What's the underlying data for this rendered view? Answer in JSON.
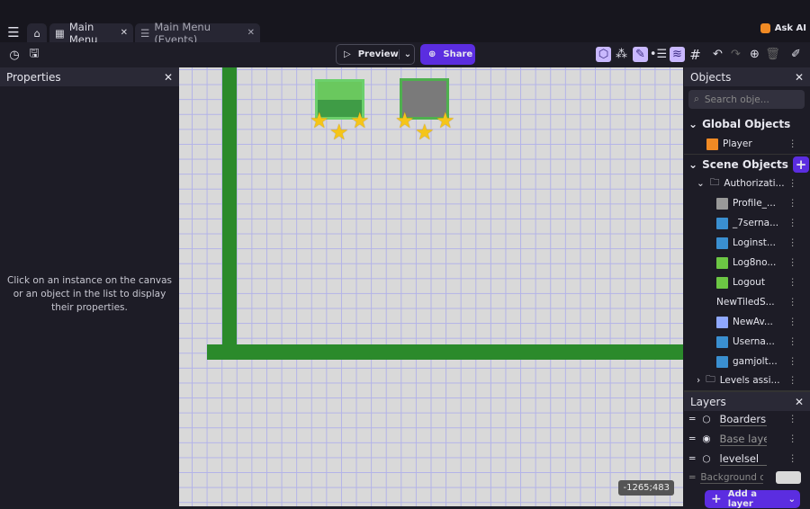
{
  "tabs": [
    {
      "label": "Main Menu",
      "icon": "film-icon"
    },
    {
      "label": "Main Menu (Events)",
      "icon": "events-icon"
    }
  ],
  "ask_ai": "Ask AI",
  "toolbar": {
    "preview": "Preview",
    "share": "Share"
  },
  "properties": {
    "title": "Properties",
    "empty_text": "Click on an instance on the canvas or an object in the list to display their properties."
  },
  "objects": {
    "title": "Objects",
    "search_placeholder": "Search obje...",
    "global_label": "Global Objects",
    "scene_label": "Scene Objects",
    "global": [
      {
        "name": "Player",
        "thumb": "#f08a24"
      }
    ],
    "folder1": "Authorizati...",
    "items": [
      {
        "name": "Profile_...",
        "thumb": "#999999"
      },
      {
        "name": "_7serna...",
        "thumb": "#3a8fd0"
      },
      {
        "name": "Loginst...",
        "thumb": "#3a8fd0"
      },
      {
        "name": "Log8no...",
        "thumb": "#6cc644"
      },
      {
        "name": "Logout",
        "thumb": "#6cc644"
      },
      {
        "name": "NewTiledS...",
        "thumb": ""
      },
      {
        "name": "NewAv...",
        "thumb": "#8fa8ff"
      },
      {
        "name": "Userna...",
        "thumb": "#3a8fd0"
      },
      {
        "name": "gamjolt...",
        "thumb": "#3a8fd0"
      }
    ],
    "folder2": "Levels assi..."
  },
  "layers": {
    "title": "Layers",
    "items": [
      "Boarders",
      "Base laye",
      "levelsel"
    ],
    "background": "Background c",
    "add": "Add a layer"
  },
  "coords": "-1265;483",
  "colors": {
    "accent": "#5b2de0",
    "green": "#2b8a2b"
  }
}
